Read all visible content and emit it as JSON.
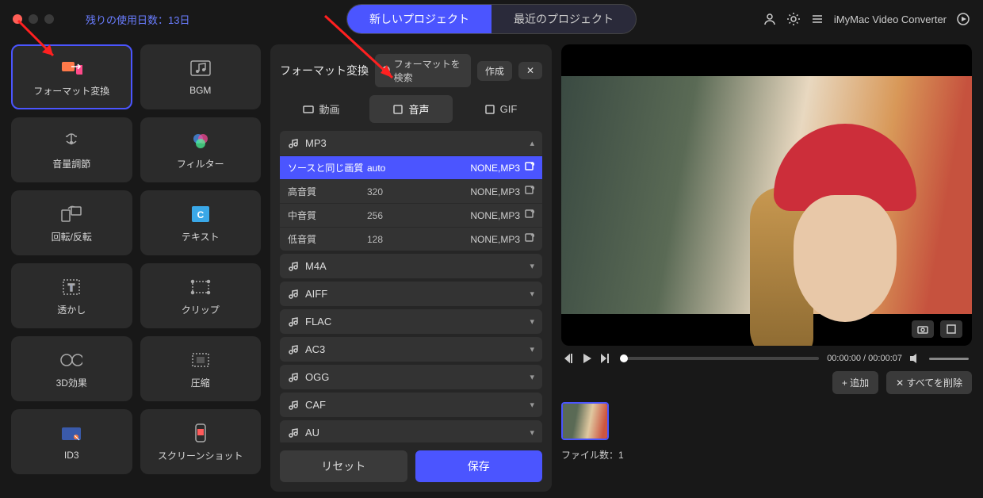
{
  "app_name": "iMyMac Video Converter",
  "trial_text": "残りの使用日数：13日",
  "top_tabs": {
    "new_project": "新しいプロジェクト",
    "recent_projects": "最近のプロジェクト"
  },
  "tools": [
    {
      "id": "format-convert",
      "label": "フォーマット変換",
      "active": true
    },
    {
      "id": "bgm",
      "label": "BGM"
    },
    {
      "id": "volume",
      "label": "音量調節"
    },
    {
      "id": "filter",
      "label": "フィルター"
    },
    {
      "id": "rotate",
      "label": "回転/反転"
    },
    {
      "id": "text",
      "label": "テキスト"
    },
    {
      "id": "watermark",
      "label": "透かし"
    },
    {
      "id": "clip",
      "label": "クリップ"
    },
    {
      "id": "3d",
      "label": "3D効果"
    },
    {
      "id": "compress",
      "label": "圧縮"
    },
    {
      "id": "id3",
      "label": "ID3"
    },
    {
      "id": "screenshot",
      "label": "スクリーンショット"
    }
  ],
  "center": {
    "title": "フォーマット変換",
    "search_placeholder": "フォーマットを検索",
    "create_label": "作成",
    "tabs": {
      "video": "動画",
      "audio": "音声",
      "gif": "GIF"
    },
    "mp3_label": "MP3",
    "mp3_presets": [
      {
        "name": "ソースと同じ画質",
        "bitrate": "auto",
        "codec": "NONE,MP3",
        "active": true
      },
      {
        "name": "高音質",
        "bitrate": "320",
        "codec": "NONE,MP3"
      },
      {
        "name": "中音質",
        "bitrate": "256",
        "codec": "NONE,MP3"
      },
      {
        "name": "低音質",
        "bitrate": "128",
        "codec": "NONE,MP3"
      }
    ],
    "groups": [
      "M4A",
      "AIFF",
      "FLAC",
      "AC3",
      "OGG",
      "CAF",
      "AU"
    ],
    "reset_label": "リセット",
    "save_label": "保存"
  },
  "player": {
    "time": "00:00:00 / 00:00:07"
  },
  "file_bar": {
    "add_label": "+ 追加",
    "delete_all_label": "すべてを削除"
  },
  "thumbs": {
    "count_label": "ファイル数：1"
  }
}
